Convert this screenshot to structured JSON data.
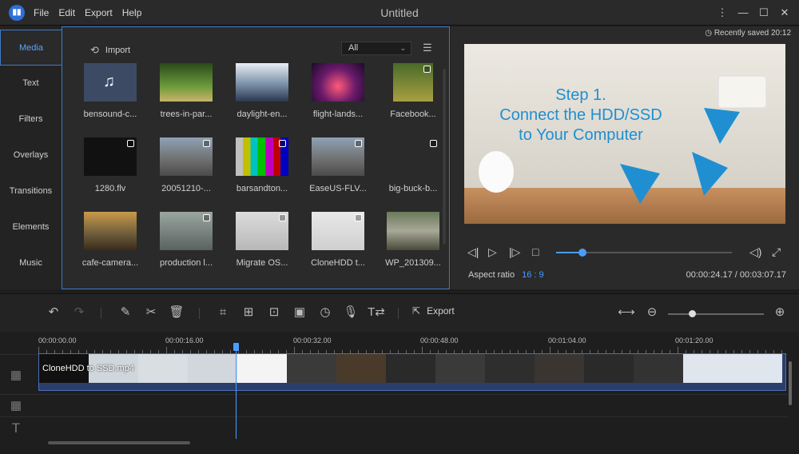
{
  "app": {
    "title": "Untitled",
    "logo": "app-logo-icon"
  },
  "menu": [
    "File",
    "Edit",
    "Export",
    "Help"
  ],
  "window_controls": [
    "more-icon",
    "minimize-icon",
    "maximize-icon",
    "close-icon"
  ],
  "sidebar": {
    "tabs": [
      {
        "label": "Media",
        "active": true
      },
      {
        "label": "Text"
      },
      {
        "label": "Filters"
      },
      {
        "label": "Overlays"
      },
      {
        "label": "Transitions"
      },
      {
        "label": "Elements"
      },
      {
        "label": "Music"
      }
    ]
  },
  "media": {
    "import_label": "Import",
    "filter_value": "All",
    "items": [
      {
        "name": "bensound-c...",
        "type": "audio"
      },
      {
        "name": "trees-in-par...",
        "type": "image"
      },
      {
        "name": "daylight-en...",
        "type": "image"
      },
      {
        "name": "flight-lands...",
        "type": "image"
      },
      {
        "name": "Facebook...",
        "type": "video"
      },
      {
        "name": "1280.flv",
        "type": "video"
      },
      {
        "name": "20051210-...",
        "type": "video"
      },
      {
        "name": "barsandton...",
        "type": "video"
      },
      {
        "name": "EaseUS-FLV...",
        "type": "video"
      },
      {
        "name": "big-buck-b...",
        "type": "video"
      },
      {
        "name": "cafe-camera...",
        "type": "image"
      },
      {
        "name": "production l...",
        "type": "video"
      },
      {
        "name": "Migrate OS...",
        "type": "video"
      },
      {
        "name": "CloneHDD t...",
        "type": "video"
      },
      {
        "name": "WP_201309...",
        "type": "video"
      }
    ]
  },
  "preview": {
    "saved": "Recently saved 20:12",
    "slide_text": [
      "Step 1.",
      "Connect the HDD/SSD",
      "to Your Computer"
    ],
    "aspect_label": "Aspect ratio",
    "aspect_value": "16 : 9",
    "time": "00:00:24.17 / 00:03:07.17",
    "progress": 0.15
  },
  "toolbar": {
    "export_label": "Export",
    "zoom": 0.25
  },
  "timeline": {
    "ruler": [
      "00:00:00.00",
      "00:00:16.00",
      "00:00:32.00",
      "00:00:48.00",
      "00:01:04.00",
      "00:01:20.00"
    ],
    "clip_label": "CloneHDD to SSD.mp4"
  },
  "colors": {
    "accent": "#4a9cff",
    "panel": "#2a2a2a",
    "clip": "#2b3e6b"
  }
}
